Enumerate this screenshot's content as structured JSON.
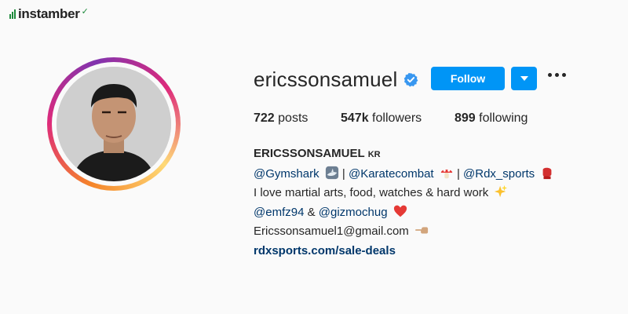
{
  "brand": {
    "name": "instamber"
  },
  "profile": {
    "username": "ericssonsamuel",
    "verified": true,
    "follow_label": "Follow",
    "stats": {
      "posts_count": "722",
      "posts_label": "posts",
      "followers_count": "547k",
      "followers_label": "followers",
      "following_count": "899",
      "following_label": "following"
    },
    "full_name": "ERICSSONSAMUEL",
    "country_tag": "KR",
    "bio": {
      "line1": {
        "m1": "@Gymshark",
        "sep1": " | ",
        "m2": "@Karatecombat",
        "sep2": " | ",
        "m3": "@Rdx_sports"
      },
      "line2": "I love martial arts, food, watches & hard work",
      "line3": {
        "m1": "@emfz94",
        "amp": " & ",
        "m2": "@gizmochug"
      },
      "line4": "Ericssonsamuel1@gmail.com",
      "website": "rdxsports.com/sale-deals"
    }
  },
  "colors": {
    "accent": "#0095f6",
    "link": "#00376b",
    "brand_green": "#1e8a3c"
  },
  "icons": [
    "verified-badge-icon",
    "chevron-down-icon",
    "more-options-icon",
    "shark-emoji",
    "mushroom-emoji",
    "boxing-glove-emoji",
    "sparkles-emoji",
    "red-heart-emoji",
    "pointing-left-emoji"
  ]
}
